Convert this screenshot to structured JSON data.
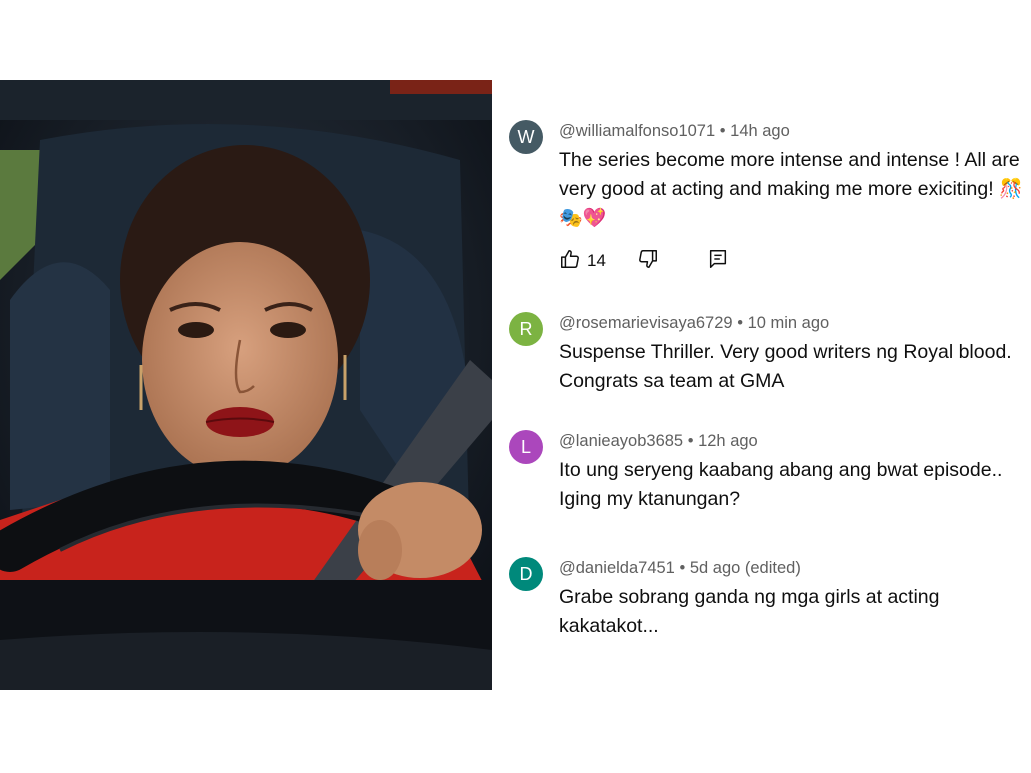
{
  "photo": {
    "alt": "woman-driving-car"
  },
  "comments": [
    {
      "avatar_letter": "W",
      "avatar_color": "#455a64",
      "handle": "@williamalfonso1071",
      "time": "14h ago",
      "text": "The series become more intense and intense ! All are very good at acting and making me more exiciting!",
      "emojis": [
        "🎊",
        "🎭",
        "💖"
      ],
      "likes": "14"
    },
    {
      "avatar_letter": "R",
      "avatar_color": "#7cb342",
      "handle": "@rosemarievisaya6729",
      "time": "10 min ago",
      "text": "Suspense Thriller. Very good writers ng Royal blood. Congrats sa team at GMA"
    },
    {
      "avatar_letter": "L",
      "avatar_color": "#ab47bc",
      "handle": "@lanieayob3685",
      "time": "12h ago",
      "text": "Ito ung seryeng kaabang abang ang bwat episode.. Iging my ktanungan?"
    },
    {
      "avatar_letter": "D",
      "avatar_color": "#00897b",
      "handle": "@danielda7451",
      "time": "5d ago (edited)",
      "text": "Grabe sobrang ganda ng mga girls at acting kakatakot..."
    }
  ],
  "separator": "•"
}
